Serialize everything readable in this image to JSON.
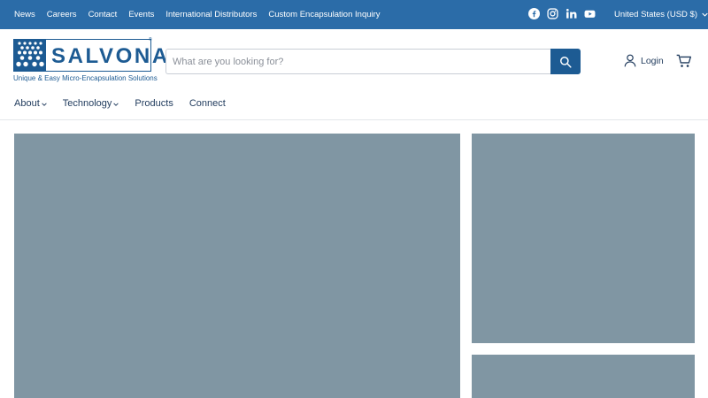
{
  "top_nav": {
    "links": [
      "News",
      "Careers",
      "Contact",
      "Events",
      "International Distributors",
      "Custom Encapsulation Inquiry"
    ],
    "social_icons": [
      "facebook-icon",
      "instagram-icon",
      "linkedin-icon",
      "youtube-icon"
    ],
    "currency_label": "United States (USD $)"
  },
  "logo": {
    "wordmark": "SALVONA",
    "registered": "®",
    "tagline": "Unique & Easy Micro-Encapsulation Solutions"
  },
  "search": {
    "placeholder": "What are you looking for?",
    "value": ""
  },
  "account": {
    "login_label": "Login"
  },
  "main_nav": {
    "items": [
      {
        "label": "About",
        "has_dropdown": true
      },
      {
        "label": "Technology",
        "has_dropdown": true
      },
      {
        "label": "Products",
        "has_dropdown": false
      },
      {
        "label": "Connect",
        "has_dropdown": false
      }
    ]
  },
  "colors": {
    "topbar": "#2b6ca8",
    "brand": "#1d5b93",
    "text": "#1f3a5c",
    "placeholder_panel": "#8096a3"
  }
}
